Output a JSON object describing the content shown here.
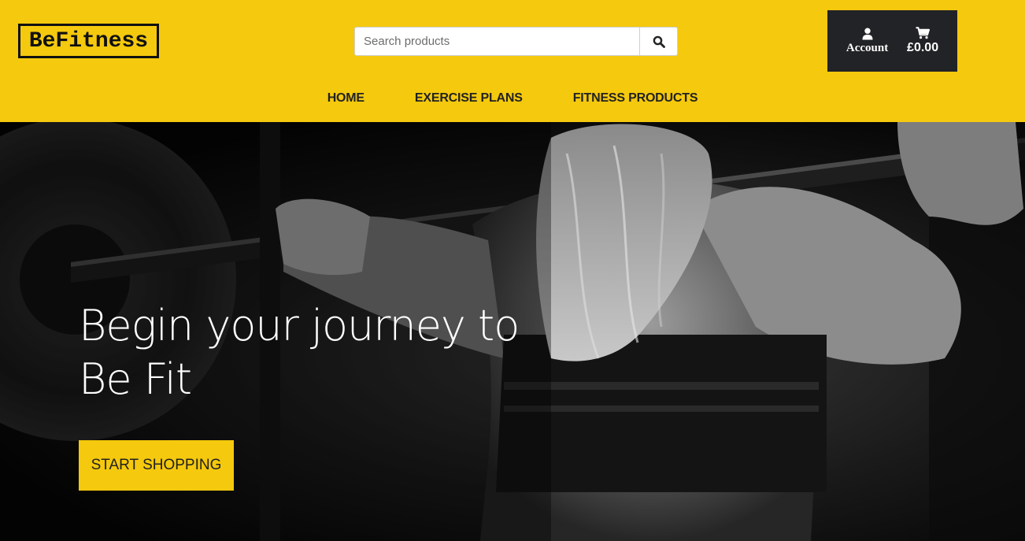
{
  "brand": {
    "logo_text": "BeFitness",
    "accent_color": "#f5c90d",
    "dark_color": "#222326"
  },
  "search": {
    "placeholder": "Search products",
    "value": "",
    "button_icon": "search-icon"
  },
  "account": {
    "account_label": "Account",
    "account_icon": "user-icon",
    "cart_total": "£0.00",
    "cart_icon": "cart-icon"
  },
  "nav": {
    "items": [
      {
        "label": "HOME"
      },
      {
        "label": "EXERCISE PLANS"
      },
      {
        "label": "FITNESS PRODUCTS"
      }
    ]
  },
  "hero": {
    "title_line1": "Begin your journey to",
    "title_line2": "Be Fit",
    "cta_label": "START SHOPPING",
    "image_description_icon": "weightlifter-photo"
  }
}
